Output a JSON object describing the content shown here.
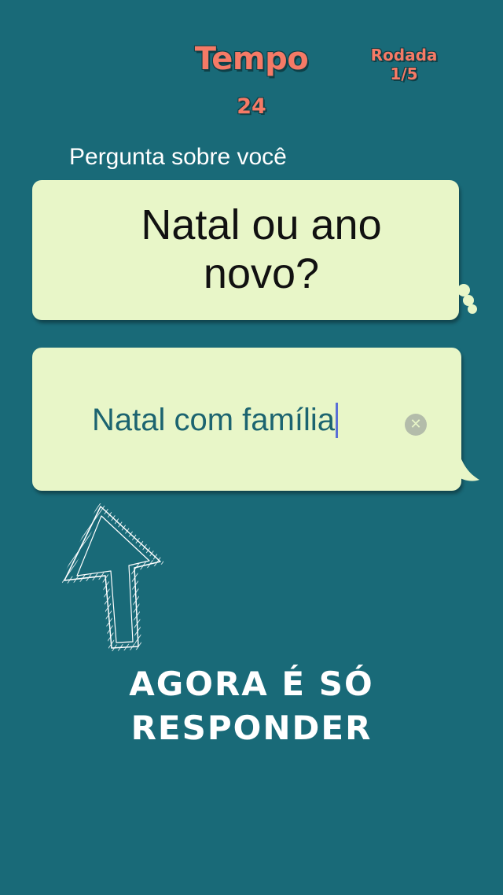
{
  "header": {
    "timer_label": "Tempo",
    "timer_value": "24",
    "round_label": "Rodada",
    "round_value": "1/5"
  },
  "question": {
    "label": "Pergunta sobre você",
    "text": "Natal ou ano novo?"
  },
  "answer": {
    "value": "Natal com família",
    "clear_icon": "clear-icon"
  },
  "hint": {
    "line1": "AGORA É SÓ",
    "line2": "RESPONDER",
    "arrow_icon": "arrow-up-icon"
  },
  "colors": {
    "background": "#196a78",
    "accent": "#f57a66",
    "bubble": "#e8f6c8",
    "answer_text": "#1c6470"
  }
}
